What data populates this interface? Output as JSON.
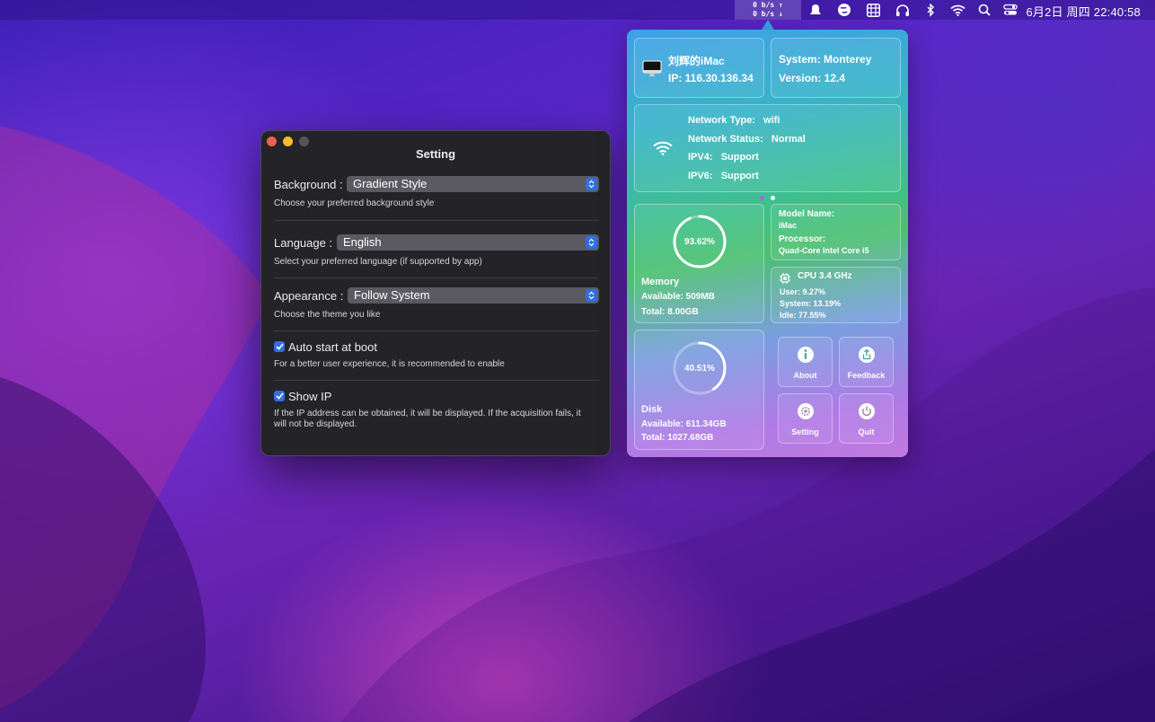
{
  "menubar": {
    "speed_up": "0 b/s ↑",
    "speed_down": "0 b/s ↓",
    "clock": "6月2日 周四  22:40:58",
    "icons": [
      "notifications-icon",
      "globe-icon",
      "grid-icon",
      "headphones-icon",
      "bluetooth-icon",
      "wifi-icon",
      "search-icon",
      "control-center-icon"
    ]
  },
  "settings": {
    "title": "Setting",
    "background": {
      "label": "Background :",
      "value": "Gradient Style",
      "hint": "Choose your preferred background style"
    },
    "language": {
      "label": "Language :",
      "value": "English",
      "hint": "Select your preferred language (if supported by app)"
    },
    "appearance": {
      "label": "Appearance :",
      "value": "Follow System",
      "hint": "Choose the theme you like"
    },
    "auto_start": {
      "label": "Auto start at boot",
      "checked": true,
      "hint": "For a better user experience, it is recommended to enable"
    },
    "show_ip": {
      "label": "Show IP",
      "checked": true,
      "hint": "If the IP address can be obtained, it will be displayed. If the acquisition fails, it will not be displayed."
    }
  },
  "panel": {
    "device": {
      "name": "刘辉的iMac",
      "ip": "IP: 116.30.136.34"
    },
    "system": {
      "name": "System: Monterey",
      "version": "Version: 12.4"
    },
    "network": {
      "type_label": "Network Type:",
      "type_value": "wifi",
      "status_label": "Network Status:",
      "status_value": "Normal",
      "ipv4_label": "IPV4:",
      "ipv4_value": "Support",
      "ipv6_label": "IPV6:",
      "ipv6_value": "Support"
    },
    "page_dots": {
      "count": 2,
      "active": 1
    },
    "memory": {
      "percent_text": "93.62%",
      "percent": 93.62,
      "title": "Memory",
      "available": "Available: 509MB",
      "total": "Total: 8.00GB"
    },
    "model": {
      "name_label": "Model Name:",
      "name_value": "iMac",
      "processor_label": "Processor:",
      "processor_value": "Quad-Core Intel Core i5"
    },
    "cpu": {
      "title": "CPU  3.4 GHz",
      "user": "User:  9.27%",
      "system": "System:  13.19%",
      "idle": "Idle:  77.55%"
    },
    "disk": {
      "percent_text": "40.51%",
      "percent": 40.51,
      "title": "Disk",
      "available": "Available: 611.34GB",
      "total": "Total: 1027.68GB"
    },
    "buttons": {
      "about": "About",
      "feedback": "Feedback",
      "setting": "Setting",
      "quit": "Quit"
    }
  }
}
